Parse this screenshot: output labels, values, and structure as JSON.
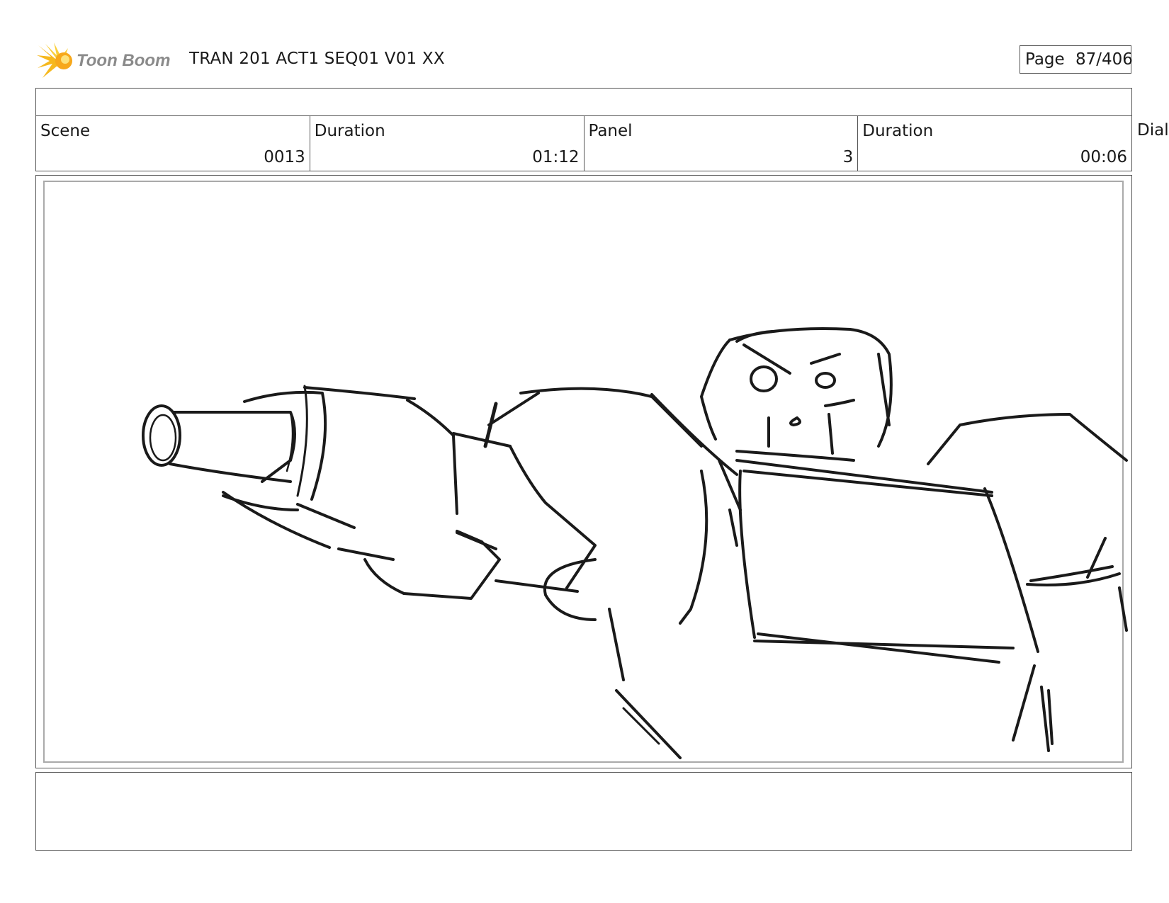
{
  "header": {
    "logo_text": "Toon Boom",
    "document_title": "TRAN 201 ACT1 SEQ01 V01 XX",
    "page_label": "Page",
    "page_value": "87/406"
  },
  "info": {
    "scene_label": "Scene",
    "scene_value": "0013",
    "scene_duration_label": "Duration",
    "scene_duration_value": "01:12",
    "panel_label": "Panel",
    "panel_value": "3",
    "panel_duration_label": "Duration",
    "panel_duration_value": "00:06",
    "cut_off_label": "Dialo"
  },
  "panel_image": {
    "content": "rough storyboard sketch of a robot aiming an arm cannon"
  },
  "notes": {
    "text": ""
  }
}
